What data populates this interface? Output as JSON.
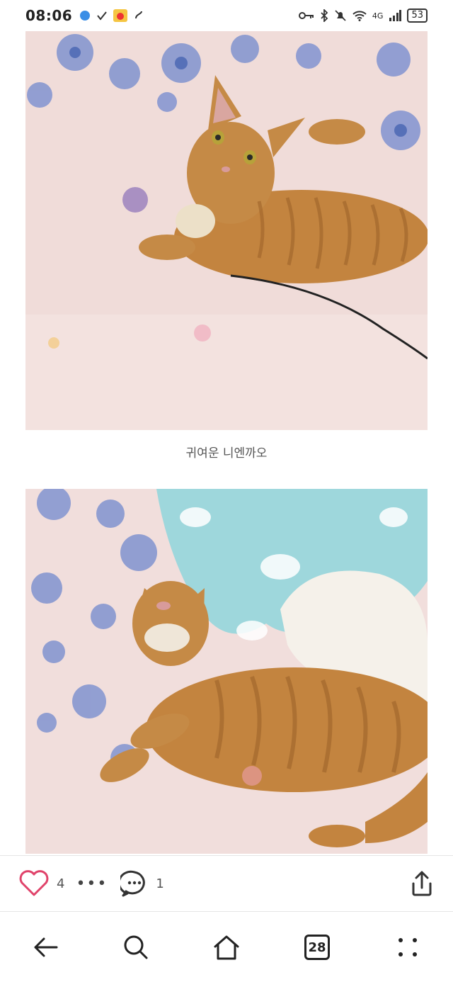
{
  "status_bar": {
    "time": "08:06",
    "network": "4G",
    "battery": "53"
  },
  "post": {
    "caption": "귀여운 니엔까오"
  },
  "actions": {
    "like_count": "4",
    "more_label": "•••",
    "comment_count": "1"
  },
  "nav": {
    "tab_count": "28"
  },
  "colors": {
    "like_heart": "#e0436a",
    "text_dark": "#333333",
    "divider": "#e6e6e6"
  }
}
